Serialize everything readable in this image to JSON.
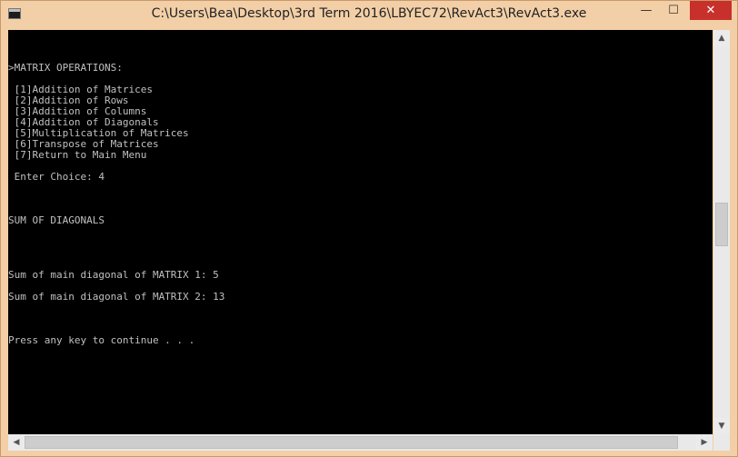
{
  "window": {
    "title": "C:\\Users\\Bea\\Desktop\\3rd Term 2016\\LBYEC72\\RevAct3\\RevAct3.exe",
    "minimize_glyph": "—",
    "maximize_glyph": "☐",
    "close_glyph": "✕"
  },
  "console": {
    "lines": [
      "",
      "",
      "",
      ">MATRIX OPERATIONS:",
      "",
      " [1]Addition of Matrices",
      " [2]Addition of Rows",
      " [3]Addition of Columns",
      " [4]Addition of Diagonals",
      " [5]Multiplication of Matrices",
      " [6]Transpose of Matrices",
      " [7]Return to Main Menu",
      "",
      " Enter Choice: 4",
      "",
      "",
      "",
      "SUM OF DIAGONALS",
      "",
      "",
      "",
      "",
      "Sum of main diagonal of MATRIX 1: 5",
      "",
      "Sum of main diagonal of MATRIX 2: 13",
      "",
      "",
      "",
      "Press any key to continue . . ."
    ]
  },
  "scrollbars": {
    "up_glyph": "▲",
    "down_glyph": "▼",
    "left_glyph": "◀",
    "right_glyph": "▶"
  },
  "icons": {
    "app": "console-app-icon"
  }
}
